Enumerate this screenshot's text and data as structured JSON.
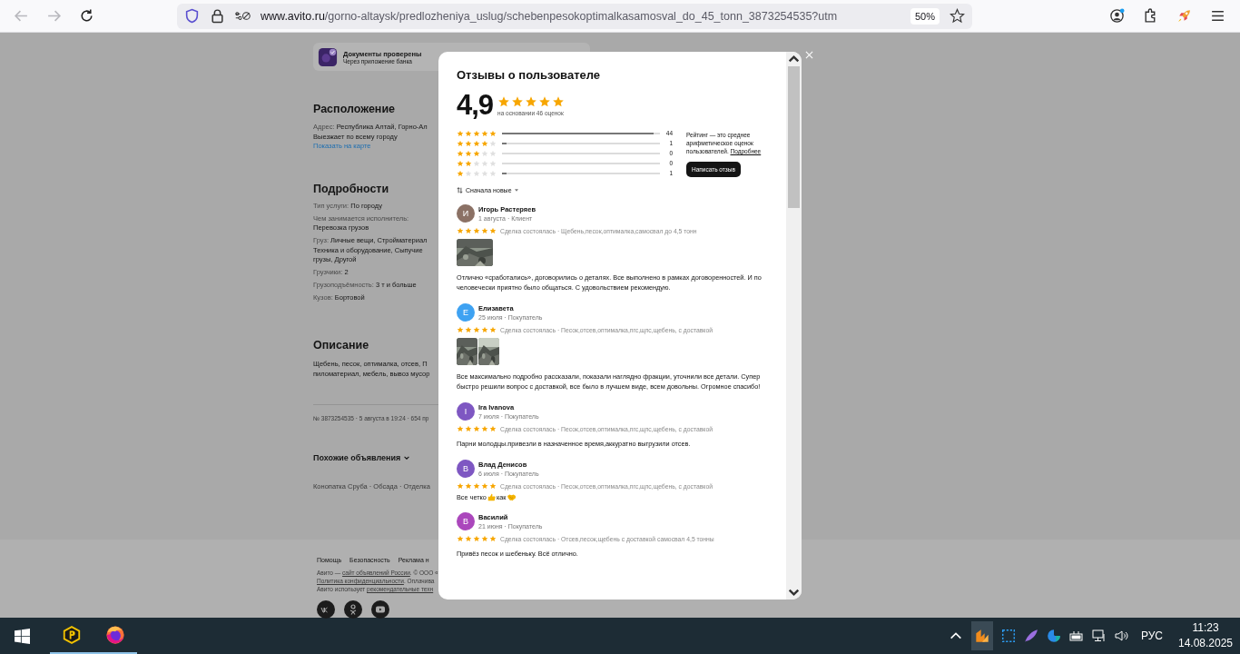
{
  "browser": {
    "url_host": "www.avito.ru",
    "url_path": "/gorno-altaysk/predlozheniya_uslug/schebenpesokoptimalkasamosval_do_45_tonn_3873254535?utm",
    "zoom": "50%"
  },
  "page": {
    "verified": {
      "title": "Документы проверены",
      "subtitle": "Через приложение банка"
    },
    "location": {
      "heading": "Расположение",
      "address_label": "Адрес:",
      "address": "Республика Алтай, Горно-Ал",
      "note": "Выезжает по всему городу",
      "map_link": "Показать на карте"
    },
    "details": {
      "heading": "Подробности",
      "rows": [
        {
          "kind": "inline",
          "label": "Тип услуги:",
          "values": [
            "По городу"
          ]
        },
        {
          "kind": "stacked",
          "label": "Чем занимается исполнитель:",
          "values": [
            "Перевозка грузов"
          ]
        },
        {
          "kind": "inline",
          "label": "Груз:",
          "values": [
            "Личные вещи, Стройматериал",
            "Техника и оборудование, Сыпучие",
            "грузы, Другой"
          ]
        },
        {
          "kind": "inline",
          "label": "Грузчики:",
          "values": [
            "2"
          ]
        },
        {
          "kind": "inline",
          "label": "Грузоподъёмность:",
          "values": [
            "3 т и больше"
          ]
        },
        {
          "kind": "inline",
          "label": "Кузов:",
          "values": [
            "Бортовой"
          ]
        }
      ]
    },
    "description": {
      "heading": "Описание",
      "lines": [
        "Щебень, песок, оптималка, отсев, П",
        "пиломатериал, мебель, вывоз мусор"
      ]
    },
    "meta": "№ 3873254535 · 5 августа в 19:24 · 654 пр",
    "similar": {
      "heading": "Похожие объявления",
      "tags": "Конопатка Сруба · Обсада · Отделка"
    },
    "footer": {
      "links": [
        "Помощь",
        "Безопасность",
        "Реклама н"
      ],
      "lines": [
        [
          {
            "text": "Авито — "
          },
          {
            "text": "сайт объявлений России",
            "link": true
          },
          {
            "text": ". © ООО «"
          }
        ],
        [
          {
            "text": "Политика конфиденциальности",
            "link": true
          },
          {
            "text": ". Оплачива"
          }
        ],
        [
          {
            "text": "Авито использует "
          },
          {
            "text": "рекомендательные техн",
            "link": true
          }
        ]
      ]
    }
  },
  "modal": {
    "title": "Отзывы о пользователе",
    "rating": "4,9",
    "stars": 5,
    "based_on": "на основании 46 оценок",
    "distribution": [
      {
        "stars": 5,
        "level": 0.96,
        "count": "44"
      },
      {
        "stars": 4,
        "level": 0.03,
        "count": "1"
      },
      {
        "stars": 3,
        "level": 0,
        "count": "0"
      },
      {
        "stars": 2,
        "level": 0,
        "count": "0"
      },
      {
        "stars": 1,
        "level": 0.03,
        "count": "1"
      }
    ],
    "info": "Рейтинг — это среднее арифметическое оценок пользователей.",
    "info_link": "Подробнее",
    "write_button": "Написать отзыв",
    "sort": "Сначала новые",
    "reviews": [
      {
        "letter": "И",
        "color": "#8b7165",
        "name": "Игорь Растеряев",
        "meta": "1 августа · Клиент",
        "stars": 5,
        "deal": "Сделка состоялась · Щебень,песок,оптималка,самосвал до 4,5 тонн",
        "photos": [
          {
            "kind": "picture"
          }
        ],
        "text": "Отлично «сработались», договорились о деталях. Все выполнено в рамках договоренностей. И по человечески приятно было общаться. С удовольствием рекомендую."
      },
      {
        "letter": "Е",
        "color": "#3ea2f2",
        "name": "Елизавета",
        "meta": "25 июля · Покупатель",
        "stars": 5,
        "deal": "Сделка состоялась · Песок,отсев,оптималка,пгс,щпс,щебень, с доставкой",
        "photos": [
          {
            "kind": "picture"
          },
          {
            "kind": "picture"
          }
        ],
        "text": "Все максимально подробно рассказали, показали наглядно фракции, уточнили все детали. Супер быстро решили вопрос с доставкой, все было в лучшем виде, всем довольны. Огромное спасибо!"
      },
      {
        "letter": "I",
        "color": "#7e57c2",
        "name": "Ira Ivanova",
        "meta": "7 июля · Покупатель",
        "stars": 5,
        "deal": "Сделка состоялась · Песок,отсев,оптималка,пгс,щпс,щебень, с доставкой",
        "text": "Парни молодцы.привезли в назначенное время,аккуратно выгрузили отсев."
      },
      {
        "letter": "В",
        "color": "#7e57c2",
        "name": "Влад Денисов",
        "meta": "6 июля · Покупатель",
        "stars": 5,
        "deal": "Сделка состоялась · Песок,отсев,оптималка,пгс,щпс,щебень, с доставкой",
        "parts": [
          {
            "kind": "text",
            "text": "Все четко"
          },
          {
            "kind": "thumbs-up"
          },
          {
            "kind": "text",
            "text": "как"
          },
          {
            "kind": "handshake"
          }
        ]
      },
      {
        "letter": "В",
        "color": "#ab47bc",
        "name": "Василий",
        "meta": "21 июня · Покупатель",
        "stars": 5,
        "deal": "Сделка состоялась · Отсев,песок,щебень с доставкой самосвал 4,5 тонны",
        "text": "Привёз песок и шебеньку. Всё отлично."
      }
    ]
  },
  "taskbar": {
    "apps": [
      {
        "kind": "hex",
        "running": true
      },
      {
        "kind": "firefox",
        "running": true
      }
    ],
    "language": "РУС",
    "time": "11:23",
    "date": "14.08.2025"
  }
}
